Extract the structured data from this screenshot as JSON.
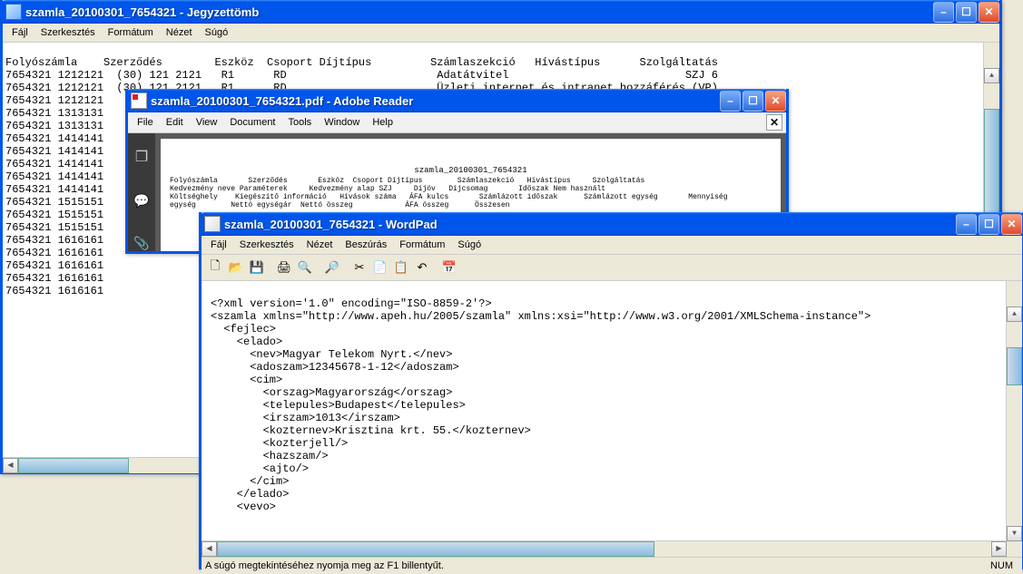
{
  "notepad": {
    "title": "szamla_20100301_7654321 - Jegyzettömb",
    "menu": [
      "Fájl",
      "Szerkesztés",
      "Formátum",
      "Nézet",
      "Súgó"
    ],
    "header": "Folyószámla    Szerződés        Eszköz  Csoport Díjtípus         Számlaszekció   Hívástípus      Szolgáltatás",
    "rows": [
      "7654321 1212121  (30) 121 2121   R1      RD                       Adatátvitel                           SZJ 6",
      "7654321 1212121  (30) 121 2121   R1      RD                       Üzleti internet és intranet hozzáférés (VP)",
      "7654321 1212121",
      "7654321 1313131",
      "7654321 1313131",
      "7654321 1414141",
      "7654321 1414141",
      "7654321 1414141",
      "7654321 1414141",
      "7654321 1414141",
      "7654321 1515151",
      "7654321 1515151",
      "7654321 1515151",
      "7654321 1616161",
      "7654321 1616161",
      "7654321 1616161",
      "7654321 1616161",
      "7654321 1616161"
    ]
  },
  "adobe": {
    "title": "szamla_20100301_7654321.pdf - Adobe Reader",
    "menu": [
      "File",
      "Edit",
      "View",
      "Document",
      "Tools",
      "Window",
      "Help"
    ],
    "page_title": "szamla_20100301_7654321",
    "col_rows": [
      "Folyószámla       Szerződés       Eszköz  Csoport Díjtípus        Számlaszekció   Hívástípus     Szolgáltatás",
      "Kedvezmény neve Paraméterek     Kedvezmény alap SZJ     Díjöv   Díjcsomag       Időszak Nem használt",
      "Költséghely    Kiegészítő információ   Hívások száma   ÁFA kulcs       Számlázott időszak      Számlázott egység       Mennyiség",
      "egység        Nettó egységár  Nettó összeg            ÁFA összeg      Összesen"
    ],
    "sidebar_icons": [
      "pages-icon",
      "comments-icon",
      "attachments-icon"
    ]
  },
  "wordpad": {
    "title": "szamla_20100301_7654321 - WordPad",
    "menu": [
      "Fájl",
      "Szerkesztés",
      "Nézet",
      "Beszúrás",
      "Formátum",
      "Súgó"
    ],
    "toolbar_icons": [
      "new-icon",
      "open-icon",
      "save-icon",
      "print-icon",
      "preview-icon",
      "find-icon",
      "cut-icon",
      "copy-icon",
      "paste-icon",
      "undo-icon",
      "datetime-icon"
    ],
    "xml_lines": [
      "<?xml version='1.0\" encoding=\"ISO-8859-2'?>",
      "<szamla xmlns=\"http://www.apeh.hu/2005/szamla\" xmlns:xsi=\"http://www.w3.org/2001/XMLSchema-instance\">",
      "  <fejlec>",
      "    <elado>",
      "      <nev>Magyar Telekom Nyrt.</nev>",
      "      <adoszam>12345678-1-12</adoszam>",
      "      <cim>",
      "        <orszag>Magyarország</orszag>",
      "        <telepules>Budapest</telepules>",
      "        <irszam>1013</irszam>",
      "        <kozternev>Krisztina krt. 55.</kozternev>",
      "        <kozterjell/>",
      "        <hazszam/>",
      "        <ajto/>",
      "      </cim>",
      "    </elado>",
      "    <vevo>"
    ],
    "status_left": "A súgó megtekintéséhez nyomja meg az F1 billentyűt.",
    "status_right": "NUM"
  }
}
